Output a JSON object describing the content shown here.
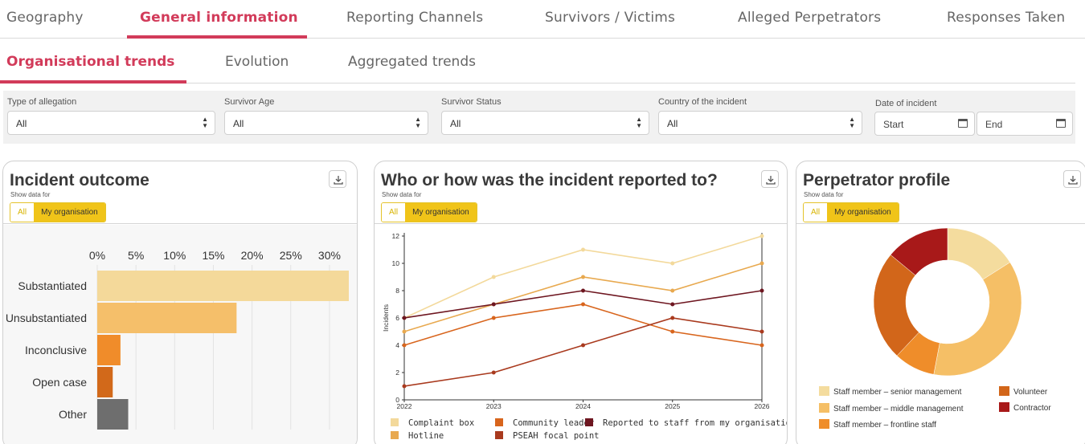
{
  "top_tabs": [
    {
      "label": "Geography"
    },
    {
      "label": "General information",
      "active": true
    },
    {
      "label": "Reporting Channels"
    },
    {
      "label": "Survivors / Victims"
    },
    {
      "label": "Alleged Perpetrators"
    },
    {
      "label": "Responses Taken"
    }
  ],
  "sub_tabs": [
    {
      "label": "Organisational trends",
      "active": true
    },
    {
      "label": "Evolution"
    },
    {
      "label": "Aggregated trends"
    }
  ],
  "filters": {
    "type_of_allegation": {
      "label": "Type of allegation",
      "value": "All"
    },
    "survivor_age": {
      "label": "Survivor Age",
      "value": "All"
    },
    "survivor_status": {
      "label": "Survivor Status",
      "value": "All"
    },
    "country": {
      "label": "Country of the incident",
      "value": "All"
    },
    "date": {
      "label": "Date of incident",
      "start_placeholder": "Start",
      "end_placeholder": "End"
    }
  },
  "cards": {
    "outcome": {
      "title": "Incident outcome",
      "show_for": "Show data for",
      "toggle_all": "All",
      "toggle_org": "My organisation",
      "download_icon": "download-icon"
    },
    "reported": {
      "title": "Who or how was the incident reported to?",
      "show_for": "Show data for",
      "toggle_all": "All",
      "toggle_org": "My organisation",
      "download_icon": "download-icon"
    },
    "perpetrator": {
      "title": "Perpetrator profile",
      "show_for": "Show data for",
      "toggle_all": "All",
      "toggle_org": "My organisation",
      "download_icon": "download-icon"
    }
  },
  "colors": {
    "accent": "#d23b5a",
    "toggle": "#f0c419"
  },
  "chart_data": [
    {
      "type": "bar",
      "orientation": "horizontal",
      "categories": [
        "Substantiated",
        "Unsubstantiated",
        "Inconclusive",
        "Open case",
        "Other"
      ],
      "values": [
        32.5,
        18,
        3,
        2,
        4
      ],
      "colors": [
        "#f4d99a",
        "#f5bf6a",
        "#f08c2a",
        "#d2691a",
        "#6e6e6e"
      ],
      "x_ticks": [
        "0%",
        "5%",
        "10%",
        "15%",
        "20%",
        "25%",
        "30%"
      ],
      "xlim": [
        0,
        32.5
      ],
      "axis_position": "top",
      "grid": true
    },
    {
      "type": "line",
      "ylabel": "Incidents",
      "x": [
        "2022",
        "2023",
        "2024",
        "2025",
        "2026"
      ],
      "y_ticks": [
        "0",
        "2",
        "4",
        "6",
        "8",
        "10",
        "12"
      ],
      "ylim": [
        0,
        12
      ],
      "series": [
        {
          "name": "Complaint box",
          "color": "#f3d99b",
          "values": [
            6,
            9,
            11,
            10,
            12
          ]
        },
        {
          "name": "Hotline",
          "color": "#e8a94f",
          "values": [
            5,
            7,
            9,
            8,
            10
          ]
        },
        {
          "name": "Community leader",
          "color": "#d8651d",
          "values": [
            4,
            6,
            7,
            5,
            4
          ]
        },
        {
          "name": "PSEAH focal point",
          "color": "#a93a1e",
          "values": [
            1,
            2,
            4,
            6,
            5
          ]
        },
        {
          "name": "Reported to staff from my organisation",
          "color": "#6e1620",
          "values": [
            6,
            7,
            8,
            7,
            8
          ]
        }
      ],
      "legend_position": "bottom"
    },
    {
      "type": "pie",
      "donut": true,
      "labels": [
        "Staff member – senior management",
        "Staff member – middle management",
        "Staff member – frontline staff",
        "Volunteer",
        "Contractor"
      ],
      "values": [
        16,
        37,
        9,
        24,
        14
      ],
      "colors": [
        "#f4dc9e",
        "#f5bf66",
        "#ef8d2a",
        "#d2661a",
        "#a81919"
      ],
      "legend_position": "bottom"
    }
  ]
}
